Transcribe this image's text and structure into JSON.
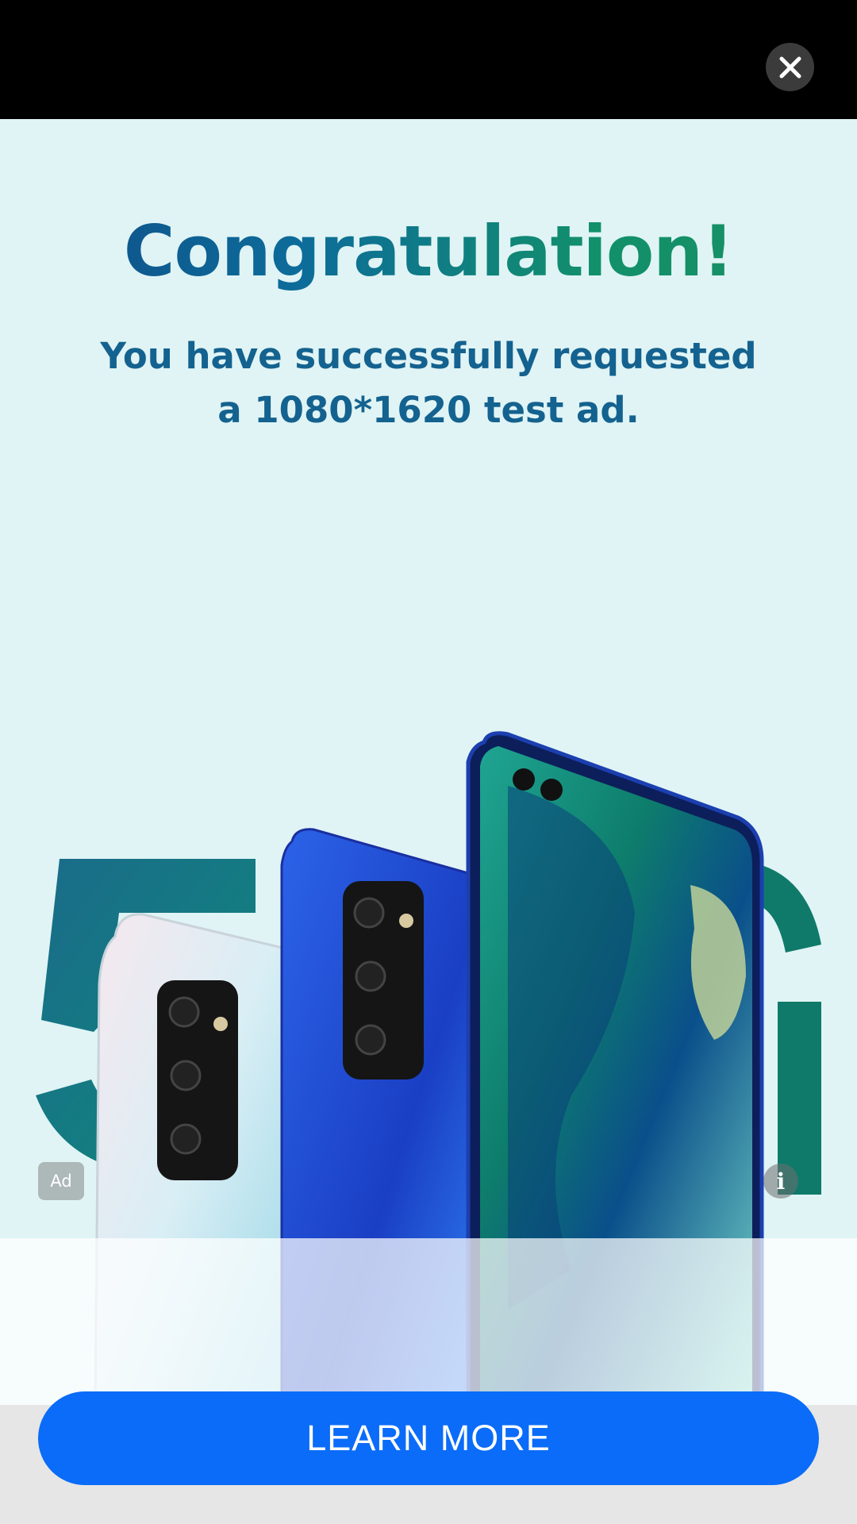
{
  "ad": {
    "headline": "Congratulation!",
    "subtitle": "You have successfully requested a 1080*1620 test ad.",
    "badge": "Ad",
    "info_glyph": "i",
    "background_text": "5G",
    "cta_label": "LEARN MORE"
  },
  "icons": {
    "close": "close-icon",
    "info": "info-icon"
  },
  "colors": {
    "top_bar": "#000000",
    "ad_background": "#e0f4f5",
    "cta": "#0a6cf8",
    "headline_start": "#0e4b86",
    "headline_end": "#1a8f62",
    "subtitle": "#14628f"
  }
}
